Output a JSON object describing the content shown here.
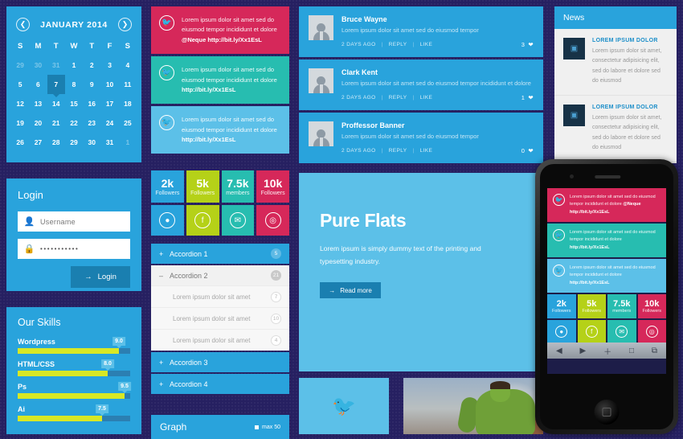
{
  "colors": {
    "background": "#262061",
    "blue": "#29a3dc",
    "light_blue": "#5cc0e8",
    "dark_blue": "#1a7fb0",
    "crimson": "#d6285a",
    "teal": "#27bdb0",
    "green": "#b5d118",
    "yellow_green": "#d8e825"
  },
  "calendar": {
    "title": "JANUARY 2014",
    "prev_icon": "chevron-left-icon",
    "next_icon": "chevron-right-icon",
    "day_headers": [
      "S",
      "M",
      "T",
      "W",
      "T",
      "F",
      "S"
    ],
    "days": [
      {
        "n": "29",
        "mute": true
      },
      {
        "n": "30",
        "mute": true
      },
      {
        "n": "31",
        "mute": true
      },
      {
        "n": "1"
      },
      {
        "n": "2"
      },
      {
        "n": "3"
      },
      {
        "n": "4"
      },
      {
        "n": "5"
      },
      {
        "n": "6"
      },
      {
        "n": "7",
        "selected": true
      },
      {
        "n": "8"
      },
      {
        "n": "9"
      },
      {
        "n": "10"
      },
      {
        "n": "11"
      },
      {
        "n": "12"
      },
      {
        "n": "13"
      },
      {
        "n": "14"
      },
      {
        "n": "15"
      },
      {
        "n": "16"
      },
      {
        "n": "17"
      },
      {
        "n": "18"
      },
      {
        "n": "19"
      },
      {
        "n": "20"
      },
      {
        "n": "21"
      },
      {
        "n": "22"
      },
      {
        "n": "23"
      },
      {
        "n": "24"
      },
      {
        "n": "25"
      },
      {
        "n": "26"
      },
      {
        "n": "27"
      },
      {
        "n": "28"
      },
      {
        "n": "29"
      },
      {
        "n": "30"
      },
      {
        "n": "31"
      },
      {
        "n": "1",
        "mute": true
      }
    ]
  },
  "login": {
    "title": "Login",
    "username_placeholder": "Username",
    "username_value": "Username",
    "password_value": "•••••••••••",
    "button_label": "Login",
    "user_icon": "user-icon",
    "lock_icon": "lock-icon",
    "arrow_icon": "arrow-right-icon"
  },
  "skills": {
    "title": "Our Skills",
    "items": [
      {
        "name": "Wordpress",
        "value": "9.0",
        "percent": 90
      },
      {
        "name": "HTML/CSS",
        "value": "8.0",
        "percent": 80
      },
      {
        "name": "Ps",
        "value": "9.5",
        "percent": 95
      },
      {
        "name": "Ai",
        "value": "7.5",
        "percent": 75
      }
    ]
  },
  "tweets": [
    {
      "icon": "twitter-icon",
      "text": "Lorem ipsum dolor sit amet sed do eiusmod tempor incididunt et dolore ",
      "link": "@Neque http://bit.ly/Xx1EsL",
      "color": "#d6285a"
    },
    {
      "icon": "twitter-icon",
      "text": "Lorem ipsum dolor sit amet sed do eiusmod tempor incididunt et dolore ",
      "link": "http://bit.ly/Xx1EsL",
      "color": "#27bdb0"
    },
    {
      "icon": "twitter-icon",
      "text": "Lorem ipsum dolor sit amet sed do eiusmod tempor incididunt et dolore ",
      "link": "http://bit.ly/Xx1EsL",
      "color": "#5cc0e8"
    }
  ],
  "stats": [
    {
      "number": "2k",
      "label": "Followers",
      "color": "#29a3dc",
      "icon": "twitter-icon",
      "glyph": "●"
    },
    {
      "number": "5k",
      "label": "Followers",
      "color": "#b5d118",
      "icon": "facebook-icon",
      "glyph": "f"
    },
    {
      "number": "7.5k",
      "label": "members",
      "color": "#27bdb0",
      "icon": "mail-icon",
      "glyph": "✉"
    },
    {
      "number": "10k",
      "label": "Followers",
      "color": "#d6285a",
      "icon": "dribbble-icon",
      "glyph": "◎"
    }
  ],
  "accordion": [
    {
      "label": "Accordion 1",
      "count": "5",
      "sign": "+",
      "open": false
    },
    {
      "label": "Accordion 2",
      "count": "21",
      "sign": "–",
      "open": true,
      "items": [
        {
          "label": "Lorem ipsum dolor sit amet",
          "count": "7"
        },
        {
          "label": "Lorem ipsum dolor sit amet",
          "count": "10"
        },
        {
          "label": "Lorem ipsum dolor sit amet",
          "count": "4"
        }
      ]
    },
    {
      "label": "Accordion 3",
      "count": "",
      "sign": "+",
      "open": false
    },
    {
      "label": "Accordion 4",
      "count": "",
      "sign": "+",
      "open": false
    }
  ],
  "graph": {
    "title": "Graph",
    "legend_label": "max 50"
  },
  "comments": [
    {
      "name": "Bruce Wayne",
      "text": "Lorem ipsum dolor sit amet sed do eiusmod tempor",
      "time": "2 DAYS AGO",
      "reply": "REPLY",
      "like": "LIKE",
      "likes": "3",
      "heart_icon": "heart-icon",
      "avatar": "avatar"
    },
    {
      "name": "Clark Kent",
      "text": "Lorem ipsum dolor sit amet sed do eiusmod tempor incididunt et dolore",
      "time": "2 DAYS AGO",
      "reply": "REPLY",
      "like": "LIKE",
      "likes": "1",
      "heart_icon": "heart-icon",
      "avatar": "avatar"
    },
    {
      "name": "Proffessor Banner",
      "text": "Lorem ipsum dolor sit amet sed do eiusmod tempor",
      "time": "2 DAYS AGO",
      "reply": "REPLY",
      "like": "LIKE",
      "likes": "0",
      "heart_icon": "heart-icon",
      "avatar": "avatar"
    }
  ],
  "feature": {
    "heading": "Pure Flats",
    "body": "Lorem ipsum is simply dummy text of the printing and typesetting industry.",
    "button_label": "Read more",
    "arrow_icon": "arrow-right-icon"
  },
  "bottom": {
    "twitter_tile_icon": "twitter-icon",
    "image_caption": ""
  },
  "news": {
    "title": "News",
    "items": [
      {
        "thumb_icon": "camera-icon",
        "title": "LOREM IPSUM DOLOR",
        "text": "Lorem ipsum dolor sit amet, consectetur adipisicing elit, sed do labore et dolore sed do eiusmod"
      },
      {
        "thumb_icon": "camera-icon",
        "title": "LOREM IPSUM DOLOR",
        "text": "Lorem ipsum dolor sit amet, consectetur adipisicing elit, sed do labore et dolore sed do eiusmod"
      }
    ]
  },
  "phone": {
    "toolbar_icons": [
      "back-icon",
      "forward-icon",
      "add-icon",
      "bookmarks-icon",
      "tabs-icon"
    ],
    "toolbar_glyphs": [
      "◀",
      "▶",
      "＋",
      "□",
      "⧉"
    ],
    "home_button": "home-button"
  }
}
